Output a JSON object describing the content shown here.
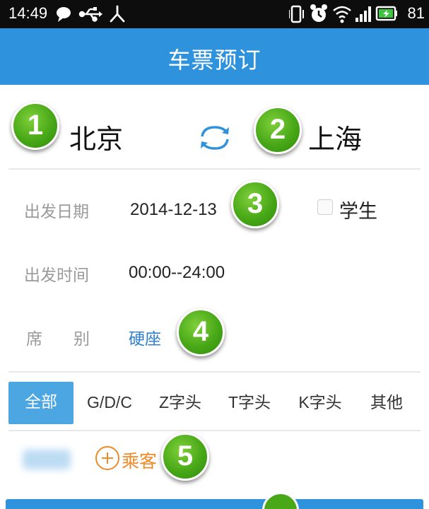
{
  "status_bar": {
    "time": "14:49",
    "battery": "81",
    "left_icons": [
      "chat-bubble-icon",
      "usb-icon",
      "debug-icon"
    ],
    "right_icons": [
      "vibrate-icon",
      "alarm-icon",
      "wifi-icon",
      "signal-icon",
      "battery-icon"
    ]
  },
  "header": {
    "title": "车票预订"
  },
  "route": {
    "from_city": "北京",
    "to_city": "上海",
    "swap_icon": "swap-arrows-icon",
    "badge_from": "1",
    "badge_to": "2"
  },
  "form": {
    "date_label": "出发日期",
    "date_value": "2014-12-13",
    "badge_date": "3",
    "student_label": "学生",
    "student_checked": false,
    "time_label": "出发时间",
    "time_value": "00:00--24:00",
    "seat_label_1": "席",
    "seat_label_2": "别",
    "seat_value": "硬座",
    "badge_seat": "4"
  },
  "train_tabs": {
    "items": [
      "全部",
      "G/D/C",
      "Z字头",
      "T字头",
      "K字头",
      "其他"
    ],
    "selected_index": 0
  },
  "passengers": {
    "add_label": "乘客",
    "badge_passenger": "5"
  },
  "colors": {
    "header_blue": "#2f92dc",
    "tab_active": "#4ba6e2",
    "seat_blue": "#2f7fd0",
    "add_orange": "#f08a28",
    "badge_green": "#48a817"
  }
}
